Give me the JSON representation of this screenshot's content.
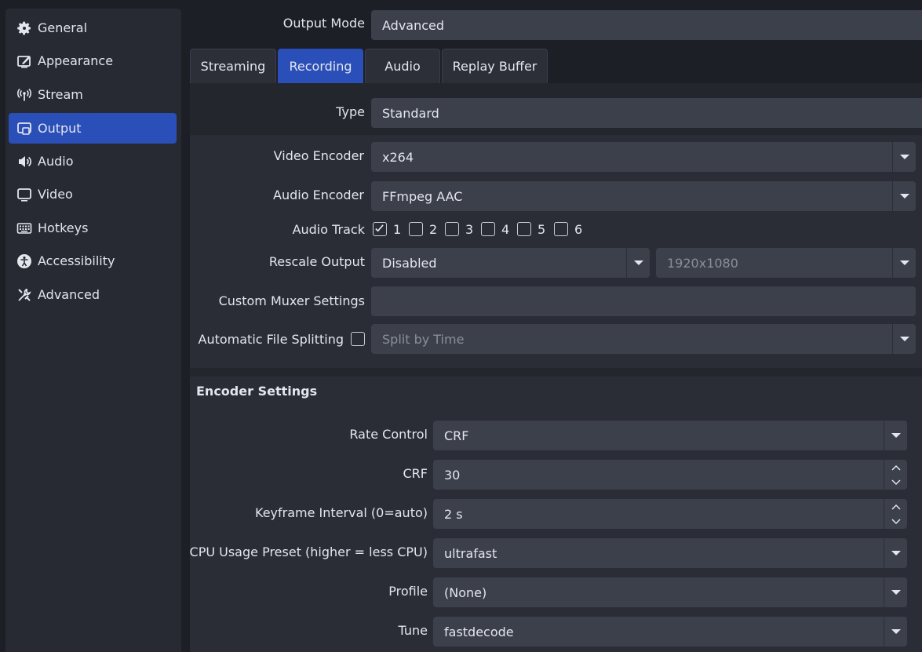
{
  "sidebar": {
    "items": [
      {
        "label": "General",
        "icon": "gear-icon"
      },
      {
        "label": "Appearance",
        "icon": "appearance-icon"
      },
      {
        "label": "Stream",
        "icon": "antenna-icon"
      },
      {
        "label": "Output",
        "icon": "output-icon"
      },
      {
        "label": "Audio",
        "icon": "speaker-icon"
      },
      {
        "label": "Video",
        "icon": "monitor-icon"
      },
      {
        "label": "Hotkeys",
        "icon": "keyboard-icon"
      },
      {
        "label": "Accessibility",
        "icon": "accessibility-icon"
      },
      {
        "label": "Advanced",
        "icon": "tools-icon"
      }
    ],
    "active": "Output"
  },
  "output_mode": {
    "label": "Output Mode",
    "value": "Advanced"
  },
  "tabs": [
    "Streaming",
    "Recording",
    "Audio",
    "Replay Buffer"
  ],
  "active_tab": "Recording",
  "type": {
    "label": "Type",
    "value": "Standard"
  },
  "recording": {
    "video_encoder": {
      "label": "Video Encoder",
      "value": "x264"
    },
    "audio_encoder": {
      "label": "Audio Encoder",
      "value": "FFmpeg AAC"
    },
    "audio_track": {
      "label": "Audio Track",
      "tracks": [
        {
          "label": "1",
          "checked": true
        },
        {
          "label": "2",
          "checked": false
        },
        {
          "label": "3",
          "checked": false
        },
        {
          "label": "4",
          "checked": false
        },
        {
          "label": "5",
          "checked": false
        },
        {
          "label": "6",
          "checked": false
        }
      ]
    },
    "rescale_output": {
      "label": "Rescale Output",
      "value": "Disabled",
      "resolution": "1920x1080"
    },
    "custom_muxer": {
      "label": "Custom Muxer Settings",
      "value": ""
    },
    "file_splitting": {
      "label": "Automatic File Splitting",
      "checked": false,
      "value": "Split by Time"
    }
  },
  "encoder_settings": {
    "title": "Encoder Settings",
    "rate_control": {
      "label": "Rate Control",
      "value": "CRF"
    },
    "crf": {
      "label": "CRF",
      "value": "30"
    },
    "keyframe": {
      "label": "Keyframe Interval (0=auto)",
      "value": "2 s"
    },
    "cpu_preset": {
      "label": "CPU Usage Preset (higher = less CPU)",
      "value": "ultrafast"
    },
    "profile": {
      "label": "Profile",
      "value": "(None)"
    },
    "tune": {
      "label": "Tune",
      "value": "fastdecode"
    }
  },
  "colors": {
    "accent": "#2a4fb8",
    "field": "#3c404b",
    "background": "#1d1f26"
  }
}
